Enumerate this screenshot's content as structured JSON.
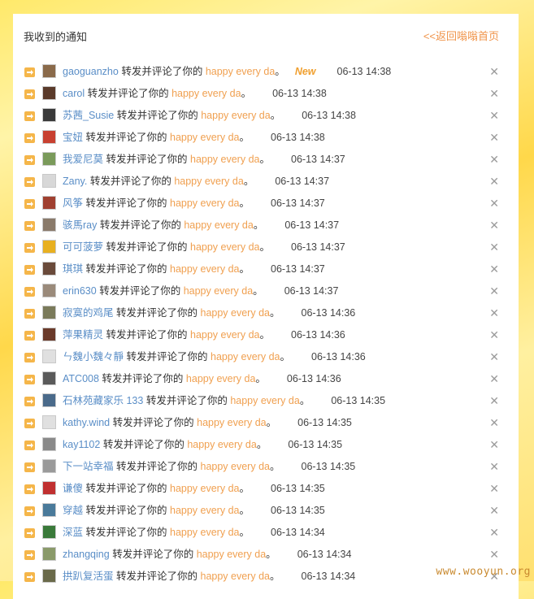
{
  "header": {
    "title": "我收到的通知",
    "back_label": "<<返回嗡嗡首页"
  },
  "action_text": "转发并评论了你的",
  "post_title": "happy every da",
  "post_suffix": "。",
  "new_label": "New",
  "close_glyph": "✕",
  "notifications": [
    {
      "user": "gaoguanzho",
      "time": "06-13 14:38",
      "is_new": true
    },
    {
      "user": "carol",
      "time": "06-13 14:38"
    },
    {
      "user": "苏茜_Susie",
      "time": "06-13 14:38"
    },
    {
      "user": "宝妞",
      "time": "06-13 14:38"
    },
    {
      "user": "我爱尼莫",
      "time": "06-13 14:37"
    },
    {
      "user": "Zany.",
      "time": "06-13 14:37"
    },
    {
      "user": "风筝",
      "time": "06-13 14:37"
    },
    {
      "user": "骇馬ray",
      "time": "06-13 14:37"
    },
    {
      "user": "可可菠萝",
      "time": "06-13 14:37"
    },
    {
      "user": "琪琪",
      "time": "06-13 14:37"
    },
    {
      "user": "erin630",
      "time": "06-13 14:37"
    },
    {
      "user": "寂寞的鸡尾",
      "time": "06-13 14:36"
    },
    {
      "user": "萍果精灵",
      "time": "06-13 14:36"
    },
    {
      "user": "ㄣ魏小魏々靜",
      "time": "06-13 14:36"
    },
    {
      "user": "ATC008",
      "time": "06-13 14:36"
    },
    {
      "user": "石林苑藏家乐 133",
      "time": "06-13 14:35"
    },
    {
      "user": "kathy.wind",
      "time": "06-13 14:35"
    },
    {
      "user": "kay1102",
      "time": "06-13 14:35"
    },
    {
      "user": "下一站幸福",
      "time": "06-13 14:35"
    },
    {
      "user": "谦傻",
      "time": "06-13 14:35"
    },
    {
      "user": "穿越",
      "time": "06-13 14:35"
    },
    {
      "user": "深蓝",
      "time": "06-13 14:34"
    },
    {
      "user": "zhangqing",
      "time": "06-13 14:34"
    },
    {
      "user": "拱趴复活蛋",
      "time": "06-13 14:34"
    }
  ],
  "watermark": "www.wooyun.org",
  "colors": {
    "accent": "#f0944a",
    "user_link": "#5a8ec7",
    "post_link": "#f0a050"
  }
}
